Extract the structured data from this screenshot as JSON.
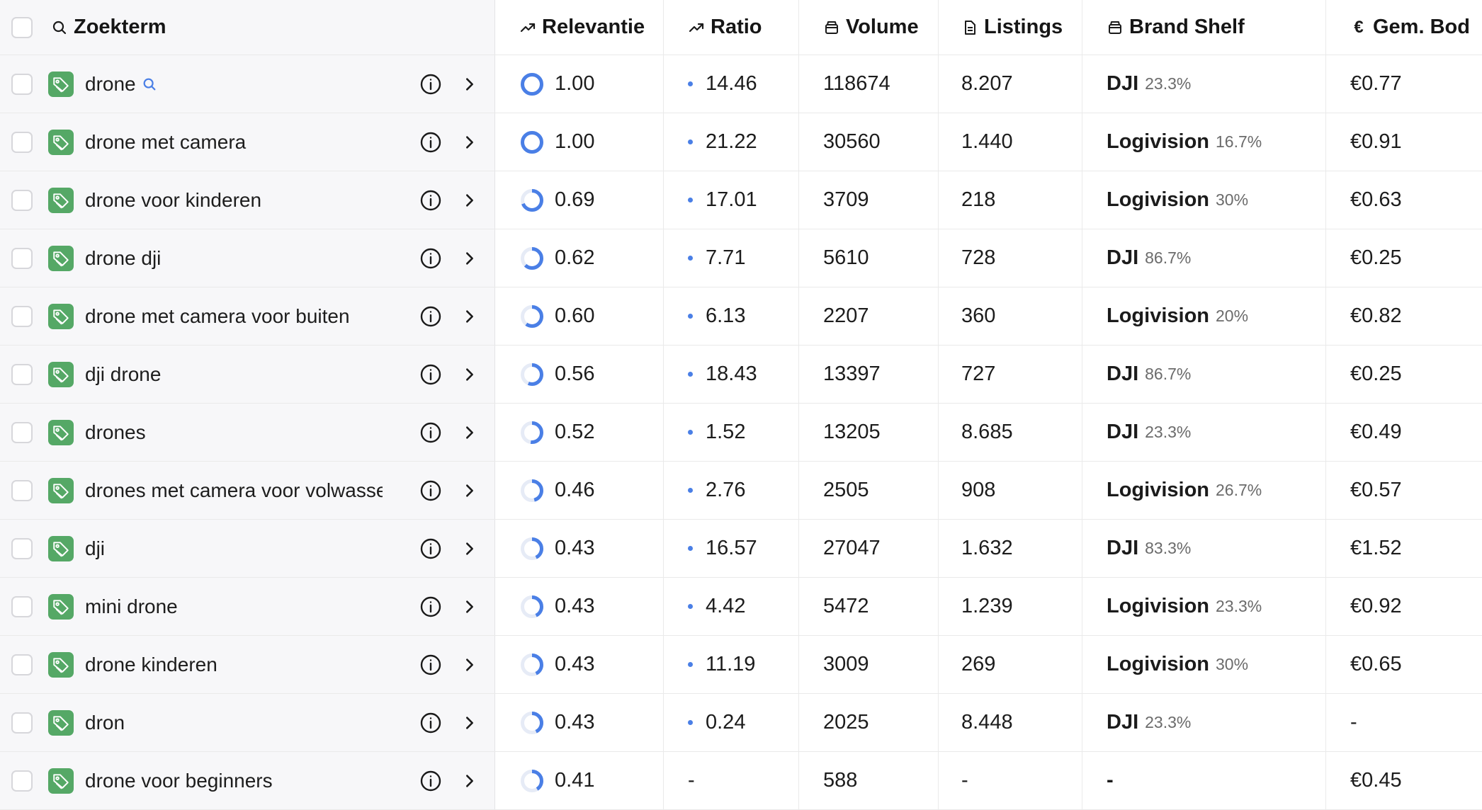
{
  "header": {
    "term_label": "Zoekterm",
    "relevance_label": "Relevantie",
    "ratio_label": "Ratio",
    "volume_label": "Volume",
    "listings_label": "Listings",
    "brand_shelf_label": "Brand Shelf",
    "bid_label": "Gem. Bod",
    "icons": {
      "term": "search-icon",
      "relevance": "trending-up-icon",
      "ratio": "trending-up-icon",
      "volume": "box-icon",
      "listings": "document-icon",
      "brand_shelf": "box-icon",
      "bid": "euro-icon"
    }
  },
  "colors": {
    "accent": "#4a7fe6",
    "tag_green": "#55a866",
    "ring_track": "#e6ebf6",
    "term_column_bg": "#f7f7f9"
  },
  "rows": [
    {
      "term": "drone",
      "searched": true,
      "relevance": "1.00",
      "relevance_value": 1.0,
      "ratio": "14.46",
      "volume": "118674",
      "listings": "8.207",
      "brand": "DJI",
      "brand_pct": "23.3%",
      "bid": "€0.77"
    },
    {
      "term": "drone met camera",
      "searched": false,
      "relevance": "1.00",
      "relevance_value": 1.0,
      "ratio": "21.22",
      "volume": "30560",
      "listings": "1.440",
      "brand": "Logivision",
      "brand_pct": "16.7%",
      "bid": "€0.91"
    },
    {
      "term": "drone voor kinderen",
      "searched": false,
      "relevance": "0.69",
      "relevance_value": 0.69,
      "ratio": "17.01",
      "volume": "3709",
      "listings": "218",
      "brand": "Logivision",
      "brand_pct": "30%",
      "bid": "€0.63"
    },
    {
      "term": "drone dji",
      "searched": false,
      "relevance": "0.62",
      "relevance_value": 0.62,
      "ratio": "7.71",
      "volume": "5610",
      "listings": "728",
      "brand": "DJI",
      "brand_pct": "86.7%",
      "bid": "€0.25"
    },
    {
      "term": "drone met camera voor buiten",
      "searched": false,
      "relevance": "0.60",
      "relevance_value": 0.6,
      "ratio": "6.13",
      "volume": "2207",
      "listings": "360",
      "brand": "Logivision",
      "brand_pct": "20%",
      "bid": "€0.82"
    },
    {
      "term": "dji drone",
      "searched": false,
      "relevance": "0.56",
      "relevance_value": 0.56,
      "ratio": "18.43",
      "volume": "13397",
      "listings": "727",
      "brand": "DJI",
      "brand_pct": "86.7%",
      "bid": "€0.25"
    },
    {
      "term": "drones",
      "searched": false,
      "relevance": "0.52",
      "relevance_value": 0.52,
      "ratio": "1.52",
      "volume": "13205",
      "listings": "8.685",
      "brand": "DJI",
      "brand_pct": "23.3%",
      "bid": "€0.49"
    },
    {
      "term": "drones met camera voor volwassenen",
      "searched": false,
      "relevance": "0.46",
      "relevance_value": 0.46,
      "ratio": "2.76",
      "volume": "2505",
      "listings": "908",
      "brand": "Logivision",
      "brand_pct": "26.7%",
      "bid": "€0.57"
    },
    {
      "term": "dji",
      "searched": false,
      "relevance": "0.43",
      "relevance_value": 0.43,
      "ratio": "16.57",
      "volume": "27047",
      "listings": "1.632",
      "brand": "DJI",
      "brand_pct": "83.3%",
      "bid": "€1.52"
    },
    {
      "term": "mini drone",
      "searched": false,
      "relevance": "0.43",
      "relevance_value": 0.43,
      "ratio": "4.42",
      "volume": "5472",
      "listings": "1.239",
      "brand": "Logivision",
      "brand_pct": "23.3%",
      "bid": "€0.92"
    },
    {
      "term": "drone kinderen",
      "searched": false,
      "relevance": "0.43",
      "relevance_value": 0.43,
      "ratio": "11.19",
      "volume": "3009",
      "listings": "269",
      "brand": "Logivision",
      "brand_pct": "30%",
      "bid": "€0.65"
    },
    {
      "term": "dron",
      "searched": false,
      "relevance": "0.43",
      "relevance_value": 0.43,
      "ratio": "0.24",
      "volume": "2025",
      "listings": "8.448",
      "brand": "DJI",
      "brand_pct": "23.3%",
      "bid": "-"
    },
    {
      "term": "drone voor beginners",
      "searched": false,
      "relevance": "0.41",
      "relevance_value": 0.41,
      "ratio": "-",
      "volume": "588",
      "listings": "-",
      "brand": "-",
      "brand_pct": "",
      "bid": "€0.45"
    }
  ]
}
